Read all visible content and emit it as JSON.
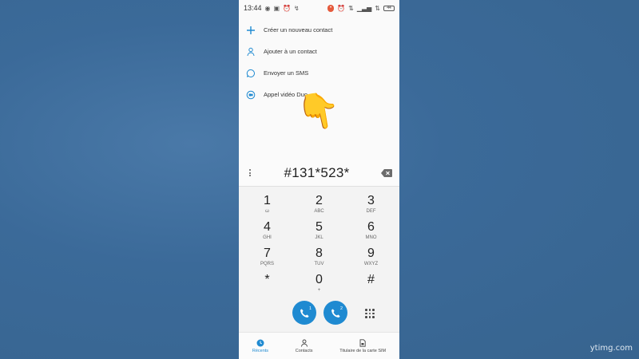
{
  "statusbar": {
    "time": "13:44",
    "battery": "44"
  },
  "actions": [
    {
      "label": "Créer un nouveau contact",
      "icon": "plus-icon"
    },
    {
      "label": "Ajouter à un contact",
      "icon": "add-contact-icon"
    },
    {
      "label": "Envoyer un SMS",
      "icon": "message-icon"
    },
    {
      "label": "Appel vidéo Duo",
      "icon": "duo-video-icon"
    }
  ],
  "overlay": {
    "hand": "👇"
  },
  "dialer": {
    "number": "#131*523*",
    "keys": [
      {
        "digit": "1",
        "letters": "ω"
      },
      {
        "digit": "2",
        "letters": "ABC"
      },
      {
        "digit": "3",
        "letters": "DEF"
      },
      {
        "digit": "4",
        "letters": "GHI"
      },
      {
        "digit": "5",
        "letters": "JKL"
      },
      {
        "digit": "6",
        "letters": "MNO"
      },
      {
        "digit": "7",
        "letters": "PQRS"
      },
      {
        "digit": "8",
        "letters": "TUV"
      },
      {
        "digit": "9",
        "letters": "WXYZ"
      },
      {
        "digit": "*",
        "letters": ""
      },
      {
        "digit": "0",
        "letters": "+"
      },
      {
        "digit": "#",
        "letters": ""
      }
    ],
    "sim1": "1",
    "sim2": "2"
  },
  "bottom_nav": [
    {
      "label": "Récents",
      "icon": "clock-icon",
      "active": true
    },
    {
      "label": "Contacts",
      "icon": "person-icon",
      "active": false
    },
    {
      "label": "Titulaire de la carte SIM",
      "icon": "sim-card-icon",
      "active": false
    }
  ],
  "watermark": "ytimg.com",
  "colors": {
    "accent": "#1f8ad1",
    "background": "#3e6d9c"
  }
}
